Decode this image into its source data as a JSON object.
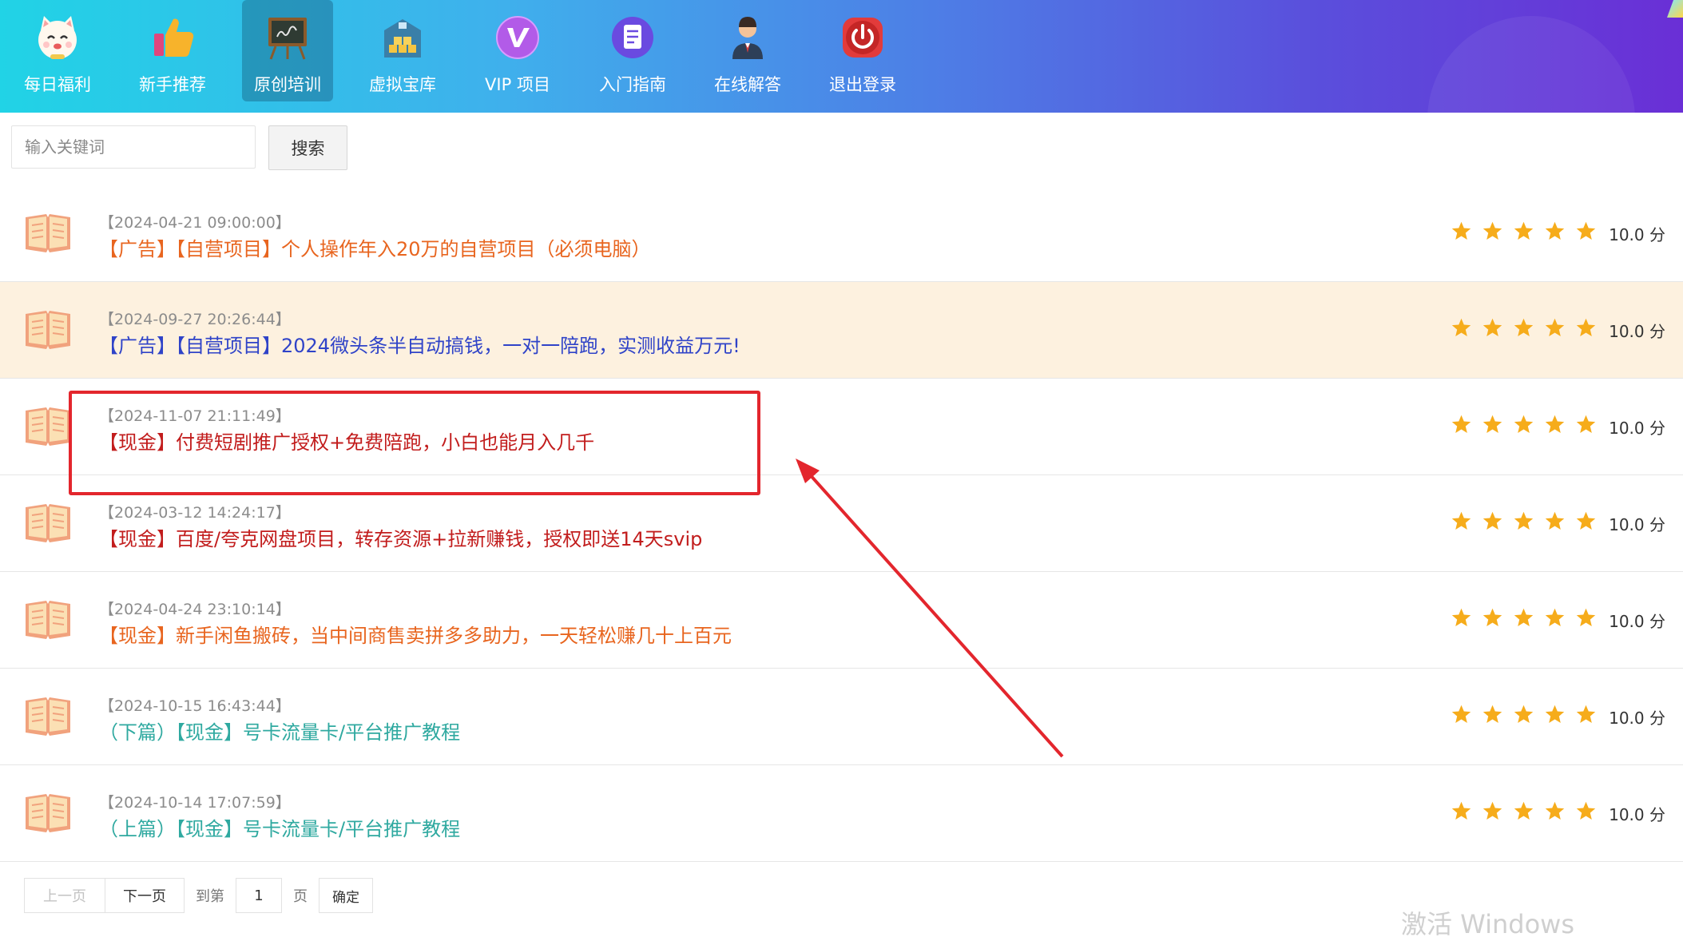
{
  "nav": {
    "items": [
      {
        "label": "每日福利",
        "icon": "lucky-cat-icon"
      },
      {
        "label": "新手推荐",
        "icon": "thumbs-up-icon"
      },
      {
        "label": "原创培训",
        "icon": "blackboard-icon",
        "active": true
      },
      {
        "label": "虚拟宝库",
        "icon": "treasure-warehouse-icon"
      },
      {
        "label": "VIP 项目",
        "icon": "vip-icon"
      },
      {
        "label": "入门指南",
        "icon": "document-icon"
      },
      {
        "label": "在线解答",
        "icon": "support-agent-icon"
      },
      {
        "label": "退出登录",
        "icon": "power-icon"
      }
    ]
  },
  "search": {
    "placeholder": "输入关键词",
    "button_label": "搜索"
  },
  "colors": {
    "ad_orange": "#e8651f",
    "ad_blue": "#2f43c8",
    "cash_red": "#c21d1d",
    "green": "#2fa9a0",
    "star": "#f6ac1b",
    "highlight_bg": "#fdf1df",
    "annotation_red": "#e3262d"
  },
  "articles": [
    {
      "date": "【2024-04-21 09:00:00】",
      "title": "【广告】【自营项目】个人操作年入20万的自营项目（必须电脑）",
      "score": "10.0 分",
      "rating": 5,
      "color": "#e8651f"
    },
    {
      "date": "【2024-09-27 20:26:44】",
      "title": "【广告】【自营项目】2024微头条半自动搞钱，一对一陪跑，实测收益万元!",
      "score": "10.0 分",
      "rating": 5,
      "color": "#2f43c8",
      "highlight": true
    },
    {
      "date": "【2024-11-07 21:11:49】",
      "title": "【现金】付费短剧推广授权+免费陪跑，小白也能月入几千",
      "score": "10.0 分",
      "rating": 5,
      "color": "#c21d1d"
    },
    {
      "date": "【2024-03-12 14:24:17】",
      "title": "【现金】百度/夸克网盘项目，转存资源+拉新赚钱，授权即送14天svip",
      "score": "10.0 分",
      "rating": 5,
      "color": "#c21d1d"
    },
    {
      "date": "【2024-04-24 23:10:14】",
      "title": "【现金】新手闲鱼搬砖，当中间商售卖拼多多助力，一天轻松赚几十上百元",
      "score": "10.0 分",
      "rating": 5,
      "color": "#e8651f"
    },
    {
      "date": "【2024-10-15 16:43:44】",
      "title": "（下篇）【现金】号卡流量卡/平台推广教程",
      "score": "10.0 分",
      "rating": 5,
      "color": "#2fa9a0"
    },
    {
      "date": "【2024-10-14 17:07:59】",
      "title": "（上篇）【现金】号卡流量卡/平台推广教程",
      "score": "10.0 分",
      "rating": 5,
      "color": "#2fa9a0"
    }
  ],
  "pager": {
    "prev_label": "上一页",
    "next_label": "下一页",
    "goto_label": "到第",
    "page_value": "1",
    "page_suffix": "页",
    "confirm_label": "确定"
  },
  "watermark": "激活 Windows"
}
